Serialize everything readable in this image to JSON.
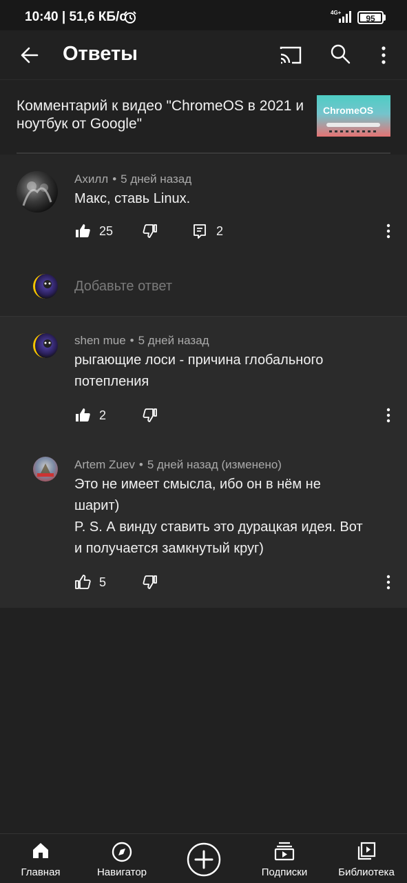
{
  "status_bar": {
    "time": "10:40 | 51,6 КБ/с",
    "network": "4G+",
    "battery": "95"
  },
  "app_bar": {
    "title": "Ответы"
  },
  "video": {
    "title": "Комментарий к видео \"ChromeOS в 2021 и ноутбук от Google\"",
    "thumbnail_text": "ChromeOS"
  },
  "comments": [
    {
      "author": "Ахилл",
      "time": "5 дней назад",
      "text": "Макс, ставь Linux.",
      "likes": "25",
      "replies": "2"
    }
  ],
  "reply_input": {
    "placeholder": "Добавьте ответ"
  },
  "replies": [
    {
      "author": "shen mue",
      "time": "5 дней назад",
      "text_lines": [
        "рыгающие лоси - причина глобального",
        "потепления"
      ],
      "likes": "2"
    },
    {
      "author": "Artem Zuev",
      "time": "5 дней назад (изменено)",
      "text_lines": [
        "Это не имеет смысла, ибо он в нём не",
        "шарит)",
        "P. S. А винду ставить это дурацкая идея. Вот",
        "и получается замкнутый круг)"
      ],
      "likes": "5"
    }
  ],
  "bottom_nav": [
    {
      "label": "Главная",
      "icon": "home-icon"
    },
    {
      "label": "Навигатор",
      "icon": "compass-icon"
    },
    {
      "label": "",
      "icon": "add-icon"
    },
    {
      "label": "Подписки",
      "icon": "subscriptions-icon"
    },
    {
      "label": "Библиотека",
      "icon": "library-icon"
    }
  ]
}
